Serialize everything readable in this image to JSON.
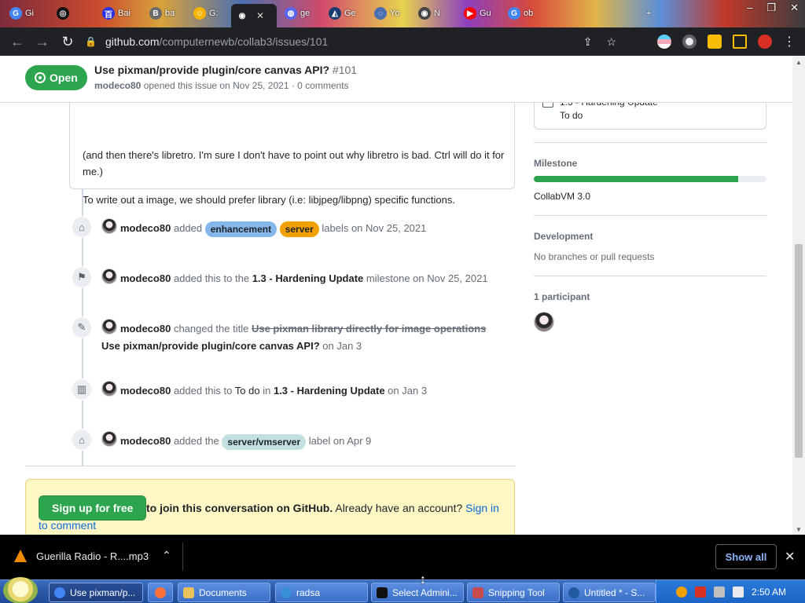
{
  "browser": {
    "tabs": [
      {
        "title": "Gi",
        "fav_color": "#4285f4",
        "fav_glyph": "G"
      },
      {
        "title": "",
        "fav_color": "#111111",
        "fav_glyph": "◎"
      },
      {
        "title": "Bai",
        "fav_color": "#2932e1",
        "fav_glyph": "百"
      },
      {
        "title": "ba",
        "fav_color": "#6b6b6b",
        "fav_glyph": "B"
      },
      {
        "title": "G:",
        "fav_color": "#f4b400",
        "fav_glyph": "☺"
      },
      {
        "title": "",
        "fav_color": "#202124",
        "fav_glyph": "◉"
      },
      {
        "title": "ge",
        "fav_color": "#5865f2",
        "fav_glyph": "◍"
      },
      {
        "title": "Ge",
        "fav_color": "#1a3b6e",
        "fav_glyph": "◭"
      },
      {
        "title": "Yo",
        "fav_color": "#4a6fb0",
        "fav_glyph": "◌"
      },
      {
        "title": "N",
        "fav_color": "#444444",
        "fav_glyph": "◉"
      },
      {
        "title": "Gu",
        "fav_color": "#ff0000",
        "fav_glyph": "▶"
      },
      {
        "title": "ob",
        "fav_color": "#4285f4",
        "fav_glyph": "G"
      }
    ],
    "new_tab": "+",
    "url_host": "github.com",
    "url_path": "/computernewb/collab3/issues/101"
  },
  "issue": {
    "state": "Open",
    "title": "Use pixman/provide plugin/core canvas API?",
    "number": "#101",
    "author": "modeco80",
    "meta_rest": "opened this issue on Nov 25, 2021 · 0 comments"
  },
  "comment": {
    "para1": "(and then there's libretro. I'm sure I don't have to point out why libretro is bad. Ctrl will do it for me.)",
    "para2": "To write out a image, we should prefer library (i.e: libjpeg/libpng) specific functions."
  },
  "timeline": {
    "e1": {
      "actor": "modeco80",
      "t1": "added",
      "label1": "enhancement",
      "label2": "server",
      "t2": "labels on Nov 25, 2021",
      "icon": "tag-icon"
    },
    "e2": {
      "actor": "modeco80",
      "t1": "added this to the",
      "milestone": "1.3 - Hardening Update",
      "t2": "milestone on Nov 25, 2021",
      "icon": "milestone-icon"
    },
    "e3": {
      "actor": "modeco80",
      "t1": "changed the title",
      "old_title": "Use pixman library directly for image operations",
      "new_title": "Use pixman/provide plugin/core canvas API?",
      "t2": "on Jan 3",
      "icon": "pencil-icon"
    },
    "e4": {
      "actor": "modeco80",
      "t1": "added this to",
      "column": "To do",
      "t_in": "in",
      "project": "1.3 - Hardening Update",
      "t2": "on Jan 3",
      "icon": "project-icon"
    },
    "e5": {
      "actor": "modeco80",
      "t1": "added the",
      "label": "server/vmserver",
      "t2": "label on Apr 9",
      "icon": "tag-icon"
    }
  },
  "signup": {
    "button": "Sign up for free",
    "bold_text": "to join this conversation on GitHub.",
    "rest": "Already have an account?",
    "link": "Sign in to comment"
  },
  "sidebar": {
    "project_name": "1.3 - Hardening Update",
    "project_status": "To do",
    "milestone_heading": "Milestone",
    "milestone_progress": 0.88,
    "milestone_name": "CollabVM 3.0",
    "development_heading": "Development",
    "development_text": "No branches or pull requests",
    "participants_heading": "1 participant"
  },
  "downloads": {
    "file": "Guerilla Radio - R....mp3",
    "show_all": "Show all"
  },
  "taskbar": {
    "items": [
      {
        "label": "Use pixman/p...",
        "active": true,
        "icon_color": "#4285f4"
      },
      {
        "label": "",
        "active": false,
        "icon_color": "#ff7139"
      },
      {
        "label": "Documents",
        "active": false,
        "icon_color": "#e8c25a"
      },
      {
        "label": "radsa",
        "active": false,
        "icon_color": "#3a8fd9"
      },
      {
        "label": "Select Admini...",
        "active": false,
        "icon_color": "#111111"
      },
      {
        "label": "Snipping Tool",
        "active": false,
        "icon_color": "#c94a4a"
      },
      {
        "label": "Untitled * - S...",
        "active": false,
        "icon_color": "#1f5aa0"
      }
    ],
    "clock": "2:50 AM"
  },
  "colors": {
    "green": "#2da44e",
    "link": "#0969da",
    "muted": "#656d76"
  }
}
